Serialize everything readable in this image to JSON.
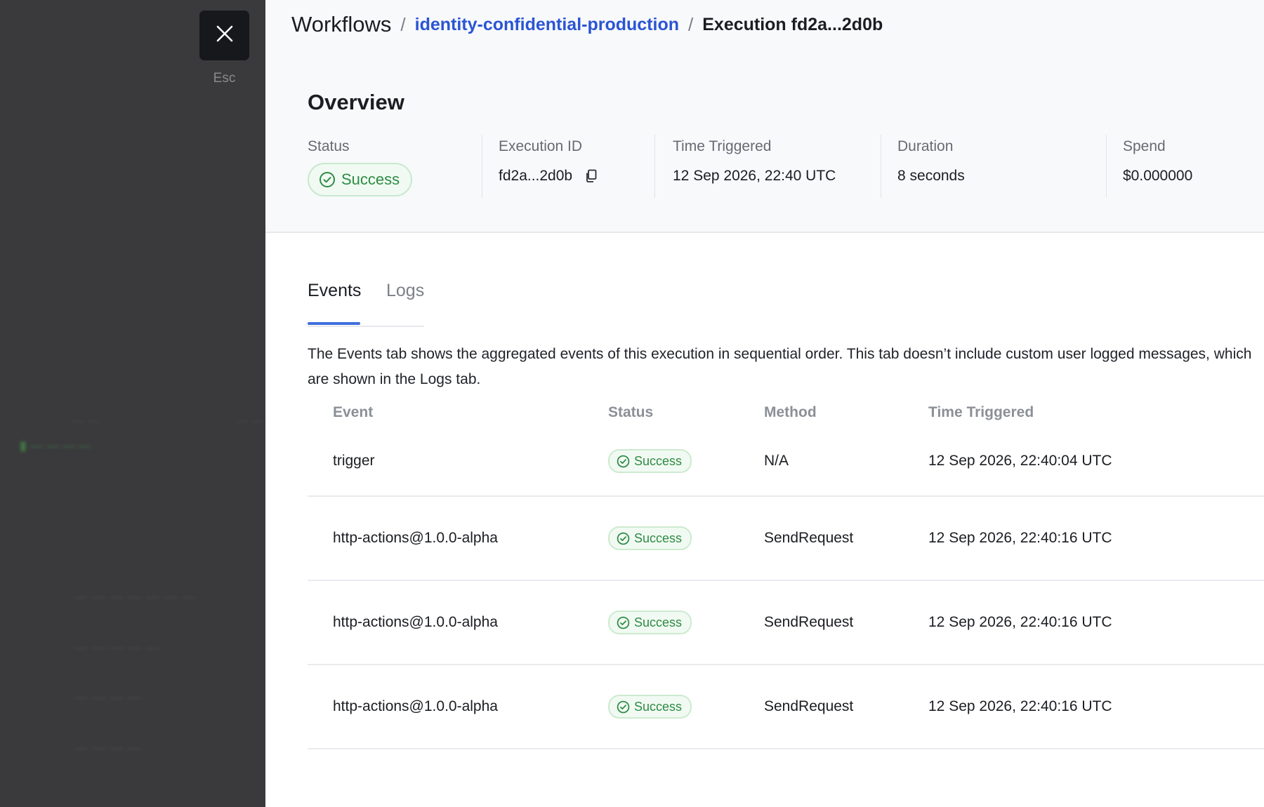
{
  "background": {
    "ghost_texts": [
      "— —",
      "— —",
      "▮ — — — —",
      "— — — — — — —",
      "— — — — —",
      "— — — —",
      "— — — —"
    ]
  },
  "close": {
    "icon": "close-icon",
    "hint": "Esc"
  },
  "breadcrumb": {
    "root": "Workflows",
    "separator": "/",
    "workflow": "identity-confidential-production",
    "current": "Execution fd2a...2d0b"
  },
  "overview": {
    "title": "Overview",
    "status": {
      "label": "Status",
      "value": "Success",
      "icon": "check-circle-icon"
    },
    "execution_id": {
      "label": "Execution ID",
      "value": "fd2a...2d0b",
      "icon": "copy-icon"
    },
    "time_triggered": {
      "label": "Time Triggered",
      "value": "12 Sep 2026, 22:40 UTC"
    },
    "duration": {
      "label": "Duration",
      "value": "8 seconds"
    },
    "spend": {
      "label": "Spend",
      "value": "$0.000000"
    }
  },
  "tabs": [
    {
      "label": "Events",
      "active": true
    },
    {
      "label": "Logs",
      "active": false
    }
  ],
  "description": "The Events tab shows the aggregated events of this execution in sequential order. This tab doesn’t include custom user logged messages, which are shown in the Logs tab.",
  "table": {
    "columns": [
      "Event",
      "Status",
      "Method",
      "Time Triggered"
    ],
    "rows": [
      {
        "event": "trigger",
        "status": "Success",
        "method": "N/A",
        "time": "12 Sep 2026, 22:40:04 UTC"
      },
      {
        "event": "http-actions@1.0.0-alpha",
        "status": "Success",
        "method": "SendRequest",
        "time": "12 Sep 2026, 22:40:16 UTC"
      },
      {
        "event": "http-actions@1.0.0-alpha",
        "status": "Success",
        "method": "SendRequest",
        "time": "12 Sep 2026, 22:40:16 UTC"
      },
      {
        "event": "http-actions@1.0.0-alpha",
        "status": "Success",
        "method": "SendRequest",
        "time": "12 Sep 2026, 22:40:16 UTC"
      }
    ]
  },
  "colors": {
    "accent": "#2a55d4",
    "tab_underline": "#3f6fdc",
    "success": "#2e8b45",
    "backdrop": "#3a3a3c",
    "close_button": "#17181c"
  }
}
